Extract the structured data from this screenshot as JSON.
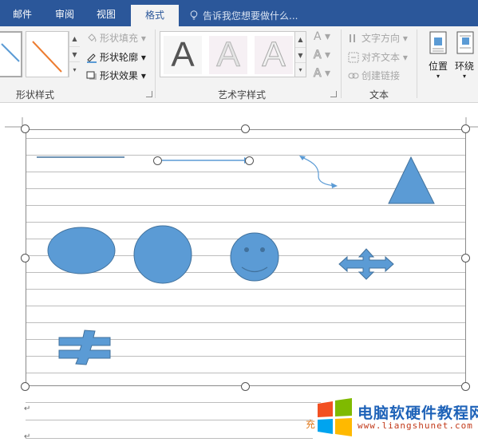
{
  "tabs": [
    {
      "label": "邮件"
    },
    {
      "label": "审阅"
    },
    {
      "label": "视图"
    },
    {
      "label": "格式"
    }
  ],
  "tell_me": "告诉我您想要做什么...",
  "ribbon": {
    "shape_styles": {
      "label": "形状样式",
      "fill": "形状填充",
      "outline": "形状轮廓",
      "effects": "形状效果"
    },
    "wordart_styles": {
      "label": "艺术字样式",
      "letters": [
        "A",
        "A",
        "A"
      ]
    },
    "text": {
      "label": "文本",
      "direction": "文字方向",
      "align": "对齐文本",
      "link": "创建链接"
    },
    "arrange": {
      "position": "位置",
      "wrap": "环绕"
    }
  },
  "watermark": {
    "title": "电脑软硬件教程网",
    "url": "www.liangshunet.com",
    "partial_char": "充"
  },
  "colors": {
    "tab_bar": "#2b579a",
    "shape_fill": "#5b9bd5",
    "shape_line": "#41719c"
  }
}
